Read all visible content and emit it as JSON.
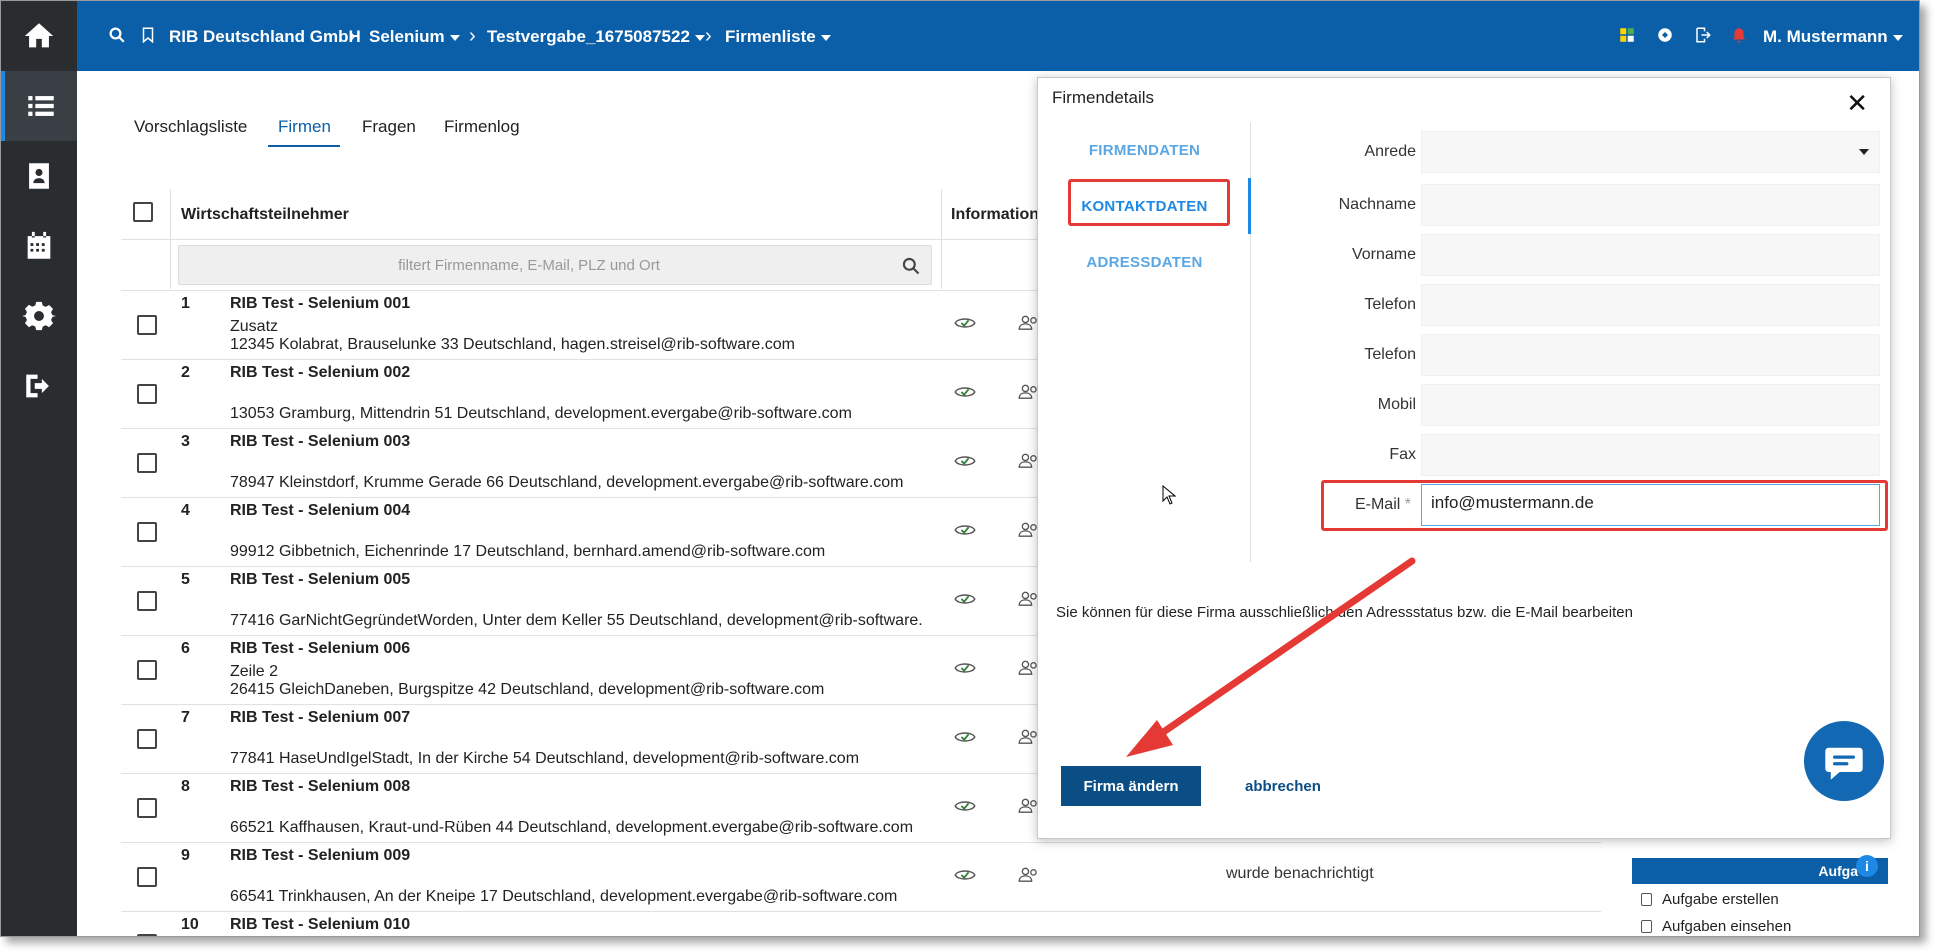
{
  "nav": {
    "items": [
      "home-icon",
      "list-icon",
      "contact-card-icon",
      "calendar-icon",
      "gear-icon",
      "logout-icon"
    ]
  },
  "topbar": {
    "org": "RIB Deutschland GmbH",
    "crumb1": "Selenium",
    "crumb2": "Testvergabe_1675087522",
    "crumb3": "Firmenliste",
    "user": "M. Mustermann"
  },
  "tabs": [
    "Vorschlagsliste",
    "Firmen",
    "Fragen",
    "Firmenlog"
  ],
  "table": {
    "col1": "Wirtschaftsteilnehmer",
    "col2": "Information",
    "filter_placeholder": "filtert Firmenname, E-Mail, PLZ und Ort",
    "rows": [
      {
        "num": "1",
        "name": "RIB Test - Selenium 001",
        "extra": "Zusatz",
        "addr": "12345 Kolabrat, Brauselunke 33 Deutschland, hagen.streisel@rib-software.com"
      },
      {
        "num": "2",
        "name": "RIB Test - Selenium 002",
        "extra": "",
        "addr": "13053 Gramburg, Mittendrin 51 Deutschland, development.evergabe@rib-software.com"
      },
      {
        "num": "3",
        "name": "RIB Test - Selenium 003",
        "extra": "",
        "addr": "78947 Kleinstdorf, Krumme Gerade 66 Deutschland, development.evergabe@rib-software.com"
      },
      {
        "num": "4",
        "name": "RIB Test - Selenium 004",
        "extra": "",
        "addr": "99912 Gibbetnich, Eichenrinde 17 Deutschland, bernhard.amend@rib-software.com"
      },
      {
        "num": "5",
        "name": "RIB Test - Selenium 005",
        "extra": "",
        "addr": "77416 GarNichtGegründetWorden, Unter dem Keller 55 Deutschland, development@rib-software."
      },
      {
        "num": "6",
        "name": "RIB Test - Selenium 006",
        "extra": "Zeile 2",
        "addr": "26415 GleichDaneben, Burgspitze 42 Deutschland, development@rib-software.com"
      },
      {
        "num": "7",
        "name": "RIB Test - Selenium 007",
        "extra": "",
        "addr": "77841 HaseUndIgelStadt, In der Kirche 54 Deutschland, development@rib-software.com"
      },
      {
        "num": "8",
        "name": "RIB Test - Selenium 008",
        "extra": "",
        "addr": "66521 Kaffhausen, Kraut-und-Rüben 44 Deutschland, development.evergabe@rib-software.com"
      },
      {
        "num": "9",
        "name": "RIB Test - Selenium 009",
        "extra": "",
        "addr": "66541 Trinkhausen, An der Kneipe 17 Deutschland, development.evergabe@rib-software.com"
      },
      {
        "num": "10",
        "name": "RIB Test - Selenium 010",
        "extra": "",
        "addr": ""
      }
    ],
    "status_row9": "wurde benachrichtigt"
  },
  "aufgaben": {
    "title": "Aufga",
    "items": [
      "Aufgabe erstellen",
      "Aufgaben einsehen"
    ]
  },
  "modal": {
    "title": "Firmendetails",
    "side": [
      "FIRMENDATEN",
      "KONTAKTDATEN",
      "ADRESSDATEN"
    ],
    "fields": {
      "anrede": "Anrede",
      "nachname": "Nachname",
      "vorname": "Vorname",
      "telefon1": "Telefon",
      "telefon2": "Telefon",
      "mobil": "Mobil",
      "fax": "Fax",
      "email": "E-Mail",
      "email_req": "*",
      "email_value": "info@mustermann.de"
    },
    "note": "Sie können für diese Firma ausschließlich den Adressstatus bzw. die E-Mail bearbeiten",
    "submit": "Firma ändern",
    "cancel": "abbrechen"
  },
  "colors": {
    "topbar": "#0b5fa8",
    "nav": "#2a2d30",
    "accent": "#1e88e5",
    "highlight": "#e53935"
  }
}
